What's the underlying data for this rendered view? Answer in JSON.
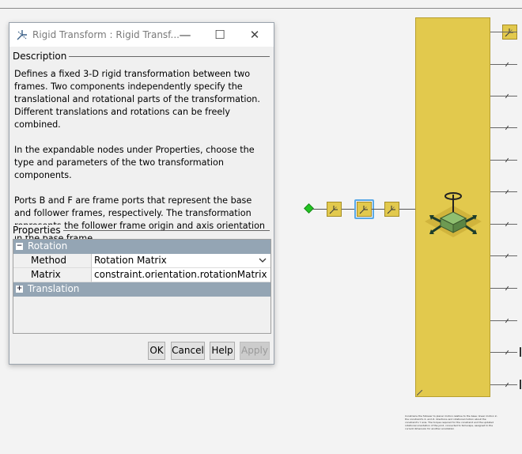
{
  "dialog": {
    "title": "Rigid Transform : Rigid Transf...",
    "window_controls": {
      "minimize": "—",
      "maximize": "☐",
      "close": "✕"
    },
    "description_label": "Description",
    "description_paragraphs": [
      "Defines a fixed 3-D rigid transformation between two frames. Two components independently specify the translational and rotational parts of the transformation. Different translations and rotations can be freely combined.",
      "In the expandable nodes under Properties, choose the type and parameters of the two transformation components.",
      "Ports B and F are frame ports that represent the base and follower frames, respectively. The transformation represents the follower frame origin and axis orientation in the base frame."
    ],
    "properties_label": "Properties",
    "rotation_group": {
      "label": "Rotation",
      "toggle": "−"
    },
    "method": {
      "label": "Method",
      "value": "Rotation Matrix"
    },
    "matrix": {
      "label": "Matrix",
      "value": "constraint.orientation.rotationMatrix"
    },
    "translation_group": {
      "label": "Translation",
      "toggle": "+"
    },
    "buttons": {
      "ok": "OK",
      "cancel": "Cancel",
      "help": "Help",
      "apply": "Apply"
    }
  },
  "canvas": {
    "block_color": "#e2c94d",
    "selection_color": "#5aa9e6",
    "port_color": "#22c322",
    "annotation_text": "Constrains the follower to planar motion relative to the base: linear motion in the constraint's X- and Z- directions and rotational motion about the constraint's Y axis. The torque required for the constraint and the updated rotational orientation of the joint, connected to Simscape, assigned to the current dimension for another annotation"
  }
}
